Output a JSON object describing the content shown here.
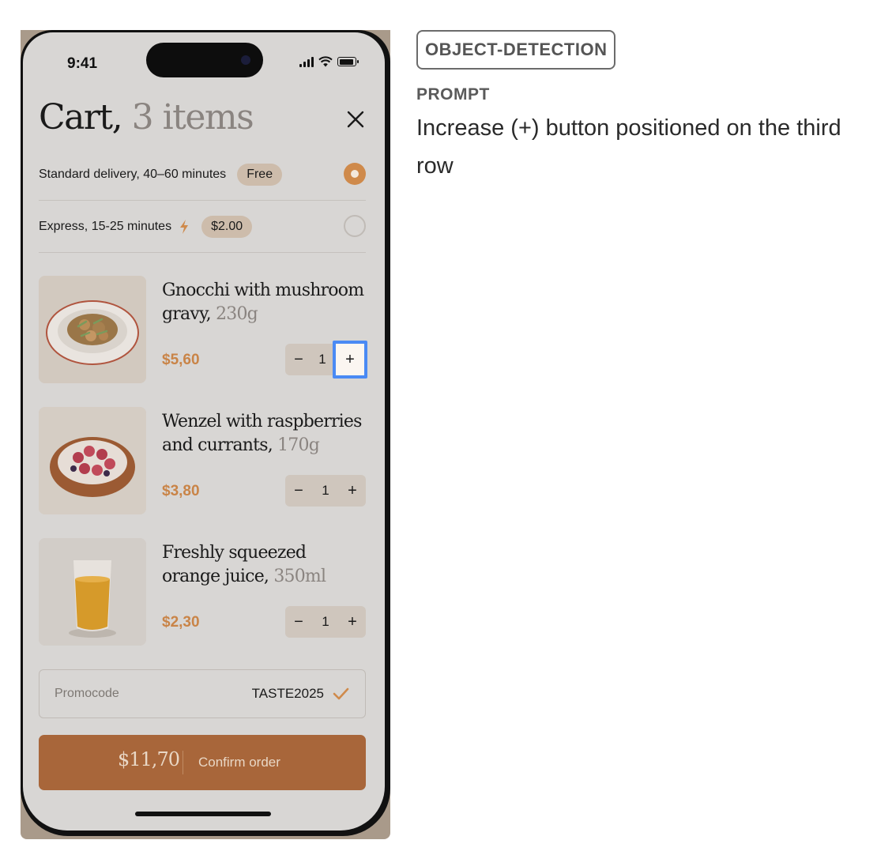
{
  "status_bar": {
    "time": "9:41"
  },
  "cart": {
    "title_main": "Cart,",
    "title_count": "3 items",
    "delivery_options": [
      {
        "label": "Standard delivery, 40–60 minutes",
        "badge": "Free",
        "selected": true
      },
      {
        "label": "Express, 15-25 minutes",
        "badge": "$2.00",
        "selected": false,
        "icon": "bolt-icon"
      }
    ],
    "items": [
      {
        "name": "Gnocchi with mushroom gravy,",
        "weight": "230g",
        "price": "$5,60",
        "qty": "1"
      },
      {
        "name": "Wenzel with raspberries and currants,",
        "weight": "170g",
        "price": "$3,80",
        "qty": "1"
      },
      {
        "name": "Freshly squeezed orange juice,",
        "weight": "350ml",
        "price": "$2,30",
        "qty": "1"
      }
    ],
    "stepper": {
      "minus": "−",
      "plus": "+"
    },
    "promo": {
      "label": "Promocode",
      "code": "TASTE2025",
      "icon": "check-icon"
    },
    "confirm": {
      "total": "$11,70",
      "label": "Confirm order"
    }
  },
  "panel": {
    "tag": "OBJECT-DETECTION",
    "prompt_heading": "PROMPT",
    "prompt_text": "Increase (+) button positioned on the third row"
  },
  "colors": {
    "accent": "#cf8a4b",
    "highlight": "#4a8af4",
    "button": "#a8663a"
  }
}
